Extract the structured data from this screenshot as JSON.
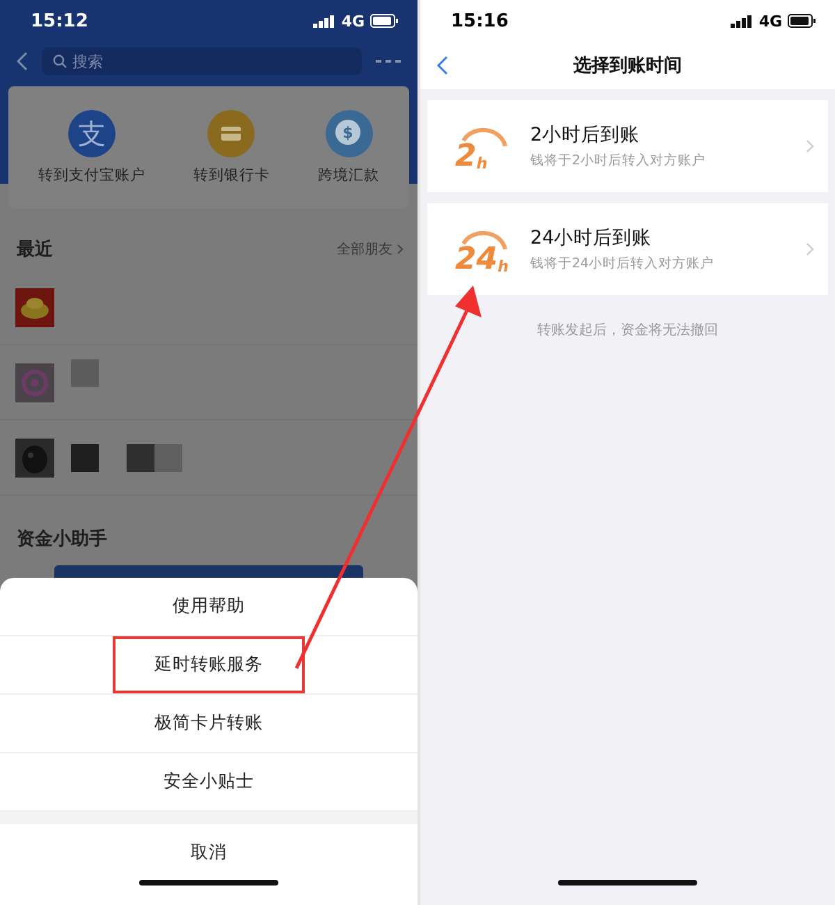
{
  "left_screen": {
    "status_bar": {
      "time": "15:12",
      "network": "4G"
    },
    "search": {
      "placeholder": "搜索"
    },
    "transfer_options": [
      {
        "label": "转到支付宝账户",
        "kind": "account",
        "glyph": "支"
      },
      {
        "label": "转到银行卡",
        "kind": "card"
      },
      {
        "label": "跨境汇款",
        "kind": "globe",
        "glyph": "$"
      }
    ],
    "recent": {
      "title": "最近",
      "link": "全部朋友"
    },
    "recent_contacts": [
      {
        "kind": "gold"
      },
      {
        "kind": "swirl"
      },
      {
        "kind": "dark"
      }
    ],
    "assistant": {
      "title": "资金小助手"
    },
    "action_sheet": {
      "items": [
        {
          "label": "使用帮助",
          "highlighted": false
        },
        {
          "label": "延时转账服务",
          "highlighted": true
        },
        {
          "label": "极简卡片转账",
          "highlighted": false
        },
        {
          "label": "安全小贴士",
          "highlighted": false
        }
      ],
      "cancel": "取消"
    }
  },
  "right_screen": {
    "status_bar": {
      "time": "15:16",
      "network": "4G"
    },
    "title": "选择到账时间",
    "options": [
      {
        "badge_number": "2",
        "badge_unit": "h",
        "title": "2小时后到账",
        "subtitle": "钱将于2小时后转入对方账户"
      },
      {
        "badge_number": "24",
        "badge_unit": "h",
        "title": "24小时后到账",
        "subtitle": "钱将于24小时后转入对方账户"
      }
    ],
    "note": "转账发起后，资金将无法撤回"
  }
}
